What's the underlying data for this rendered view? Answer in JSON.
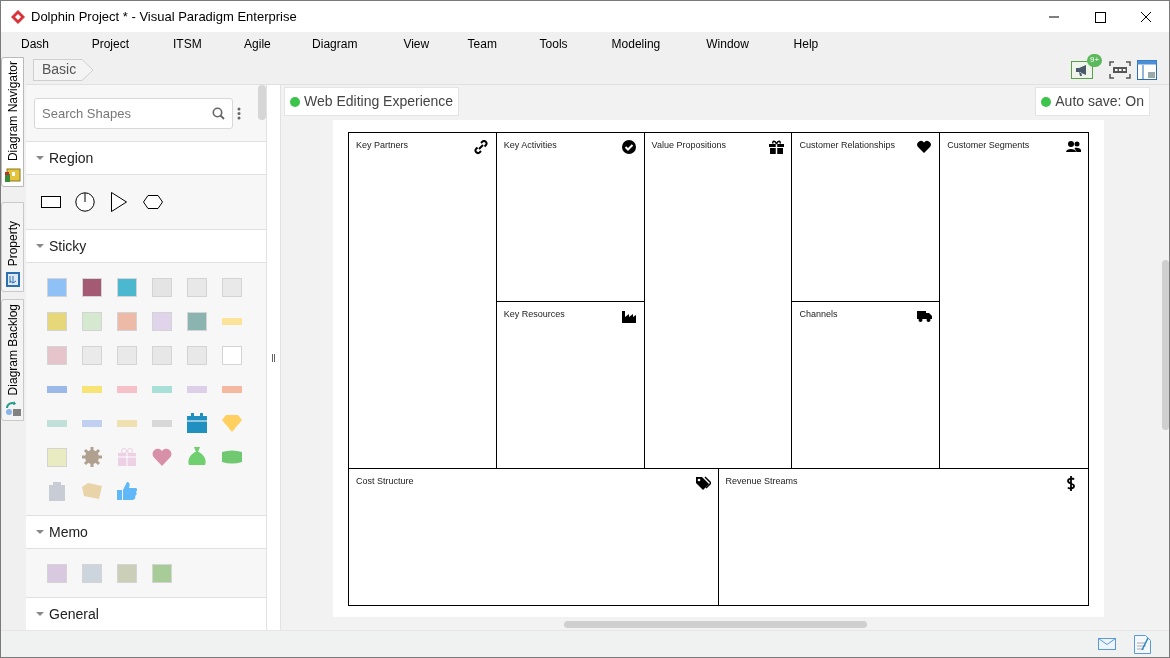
{
  "window": {
    "title": "Dolphin Project * - Visual Paradigm Enterprise"
  },
  "menu": [
    "Dash",
    "Project",
    "ITSM",
    "Agile",
    "Diagram",
    "View",
    "Team",
    "Tools",
    "Modeling",
    "Window",
    "Help"
  ],
  "side_tabs": [
    {
      "label": "Diagram Navigator",
      "kind": "navigator",
      "selected": true
    },
    {
      "label": "Property",
      "kind": "property",
      "selected": false
    },
    {
      "label": "Diagram Backlog",
      "kind": "backlog",
      "selected": false
    }
  ],
  "breadcrumb": "Basic",
  "toolbar": {
    "notification_badge": "9+"
  },
  "search": {
    "placeholder": "Search Shapes"
  },
  "shape_groups": [
    {
      "title": "Region",
      "expanded": true,
      "items": [
        {
          "kind": "rect"
        },
        {
          "kind": "clock"
        },
        {
          "kind": "triangle"
        },
        {
          "kind": "hexagon"
        }
      ]
    },
    {
      "title": "Sticky",
      "expanded": true,
      "items": [
        {
          "kind": "note",
          "color": "#8fc1f7"
        },
        {
          "kind": "note",
          "color": "#a35a72"
        },
        {
          "kind": "note",
          "color": "#4cb8d0"
        },
        {
          "kind": "note",
          "color": "#e4e4e4"
        },
        {
          "kind": "note",
          "color": "#e8e8e8"
        },
        {
          "kind": "note",
          "color": "#e9e9e9"
        },
        {
          "kind": "note",
          "color": "#e6d878"
        },
        {
          "kind": "note",
          "color": "#d5e8d0"
        },
        {
          "kind": "note",
          "color": "#eebaa8"
        },
        {
          "kind": "note",
          "color": "#e0d4ea"
        },
        {
          "kind": "note",
          "color": "#8bb3b0"
        },
        {
          "kind": "tape",
          "color": "#fbe49a"
        },
        {
          "kind": "note",
          "color": "#e6c4cc"
        },
        {
          "kind": "note",
          "color": "#eaeaea"
        },
        {
          "kind": "note",
          "color": "#e9e9e9"
        },
        {
          "kind": "note",
          "color": "#e7e7e7"
        },
        {
          "kind": "note",
          "color": "#e8e8e8"
        },
        {
          "kind": "note",
          "color": "#ffffff"
        },
        {
          "kind": "tape",
          "color": "#9ab8e8"
        },
        {
          "kind": "tape",
          "color": "#f8e474"
        },
        {
          "kind": "tape",
          "color": "#f5c0c8"
        },
        {
          "kind": "tape",
          "color": "#a8e0d8"
        },
        {
          "kind": "tape",
          "color": "#dcd0e8"
        },
        {
          "kind": "tape",
          "color": "#f4b8a0"
        },
        {
          "kind": "tape",
          "color": "#c0e0d8"
        },
        {
          "kind": "tape",
          "color": "#c0d0f0"
        },
        {
          "kind": "tape",
          "color": "#f0e0b0"
        },
        {
          "kind": "tape",
          "color": "#d8d8d8"
        },
        {
          "kind": "calendar",
          "color": "#2090c0"
        },
        {
          "kind": "gem",
          "color": "#ffd060"
        },
        {
          "kind": "note",
          "color": "#e8ecc0"
        },
        {
          "kind": "gear",
          "color": "#b0a090"
        },
        {
          "kind": "gift",
          "color": "#ecd0e4"
        },
        {
          "kind": "heart",
          "color": "#d890a8"
        },
        {
          "kind": "bag",
          "color": "#70d070"
        },
        {
          "kind": "money",
          "color": "#70c870"
        },
        {
          "kind": "clipboard",
          "color": "#c8ccd4"
        },
        {
          "kind": "tag",
          "color": "#e8d4a8"
        },
        {
          "kind": "thumb",
          "color": "#60b8f8"
        }
      ]
    },
    {
      "title": "Memo",
      "expanded": true,
      "items": [
        {
          "kind": "note",
          "color": "#d8c8e0"
        },
        {
          "kind": "note",
          "color": "#ccd4de"
        },
        {
          "kind": "note",
          "color": "#cccfb8"
        },
        {
          "kind": "note",
          "color": "#a8cc98"
        }
      ]
    },
    {
      "title": "General",
      "expanded": true
    }
  ],
  "canvas_header": {
    "web_editing": "Web Editing Experience",
    "auto_save": "Auto save: On"
  },
  "canvas": {
    "top_blocks": [
      {
        "title": "Key Partners",
        "kind": "link"
      },
      {
        "title": "Key Activities",
        "kind": "check"
      },
      {
        "title": "Key Resources",
        "kind": "factory"
      },
      {
        "title": "Value Propositions",
        "kind": "gift"
      },
      {
        "title": "Customer Relationships",
        "kind": "heart"
      },
      {
        "title": "Channels",
        "kind": "truck"
      },
      {
        "title": "Customer Segments",
        "kind": "users"
      }
    ],
    "bottom_blocks": [
      {
        "title": "Cost Structure",
        "kind": "tag"
      },
      {
        "title": "Revenue Streams",
        "kind": "dollar"
      }
    ]
  }
}
